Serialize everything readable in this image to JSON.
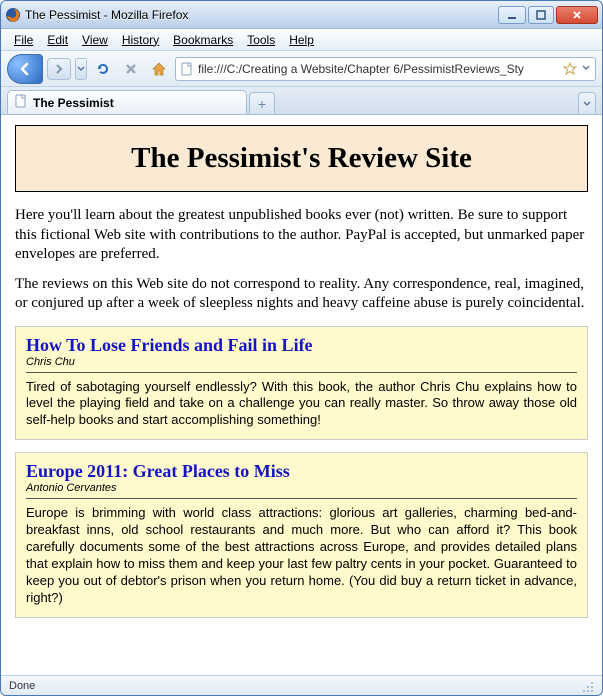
{
  "window": {
    "title": "The Pessimist - Mozilla Firefox"
  },
  "menu": {
    "file": "File",
    "edit": "Edit",
    "view": "View",
    "history": "History",
    "bookmarks": "Bookmarks",
    "tools": "Tools",
    "help": "Help"
  },
  "nav": {
    "url": "file:///C:/Creating a Website/Chapter 6/PessimistReviews_Sty"
  },
  "tabs": {
    "active": "The Pessimist",
    "newtab": "+"
  },
  "page": {
    "heading": "The Pessimist's Review Site",
    "intro1": "Here you'll learn about the greatest unpublished books ever (not) written. Be sure to support this fictional Web site with contributions to the author. PayPal is accepted, but unmarked paper envelopes are preferred.",
    "intro2": "The reviews on this Web site do not correspond to reality. Any correspondence, real, imagined, or conjured up after a week of sleepless nights and heavy caffeine abuse is purely coincidental.",
    "reviews": [
      {
        "title": "How To Lose Friends and Fail in Life",
        "author": "Chris Chu",
        "body": "Tired of sabotaging yourself endlessly? With this book, the author Chris Chu explains how to level the playing field and take on a challenge you can really master. So throw away those old self-help books and start accomplishing something!"
      },
      {
        "title": "Europe 2011: Great Places to Miss",
        "author": "Antonio Cervantes",
        "body": "Europe is brimming with world class attractions: glorious art galleries, charming bed-and-breakfast inns, old school restaurants and much more. But who can afford it? This book carefully documents some of the best attractions across Europe, and provides detailed plans that explain how to miss them and keep your last few paltry cents in your pocket. Guaranteed to keep you out of debtor's prison when you return home. (You did buy a return ticket in advance, right?)"
      }
    ]
  },
  "status": {
    "text": "Done"
  }
}
